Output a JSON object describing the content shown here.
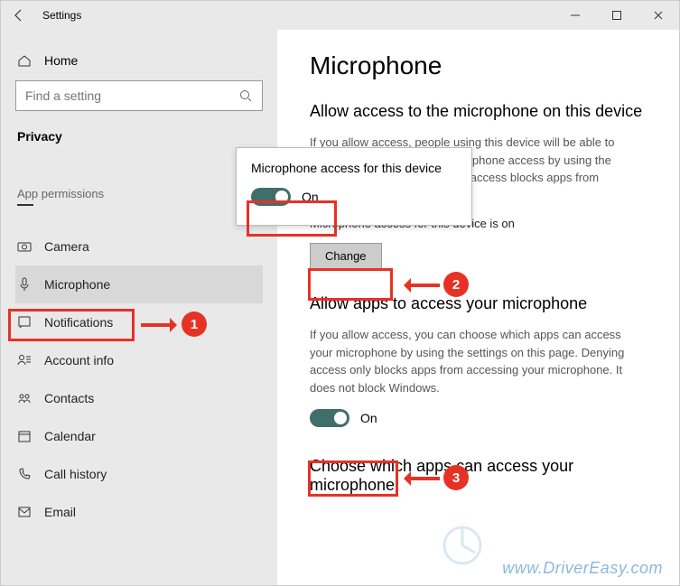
{
  "window": {
    "title": "Settings"
  },
  "sidebar": {
    "home": "Home",
    "search_placeholder": "Find a setting",
    "category": "Privacy",
    "section": "App permissions",
    "items": [
      {
        "label": "Camera"
      },
      {
        "label": "Microphone"
      },
      {
        "label": "Notifications"
      },
      {
        "label": "Account info"
      },
      {
        "label": "Contacts"
      },
      {
        "label": "Calendar"
      },
      {
        "label": "Call history"
      },
      {
        "label": "Email"
      }
    ]
  },
  "content": {
    "page_title": "Microphone",
    "s1_heading": "Allow access to the microphone on this device",
    "s1_body": "If you allow access, people using this device will be able to choose if their apps have microphone access by using the settings on this page. Denying access blocks apps from accessing the microphone.",
    "s1_status": "Microphone access for this device is on",
    "change_label": "Change",
    "s2_heading": "Allow apps to access your microphone",
    "s2_body": "If you allow access, you can choose which apps can access your microphone by using the settings on this page. Denying access only blocks apps from accessing your microphone. It does not block Windows.",
    "toggle2_label": "On",
    "s3_heading": "Choose which apps can access your microphone"
  },
  "popup": {
    "title": "Microphone access for this device",
    "toggle_label": "On"
  },
  "annotations": {
    "n1": "1",
    "n2": "2",
    "n3": "3"
  },
  "watermark": "www.DriverEasy.com"
}
